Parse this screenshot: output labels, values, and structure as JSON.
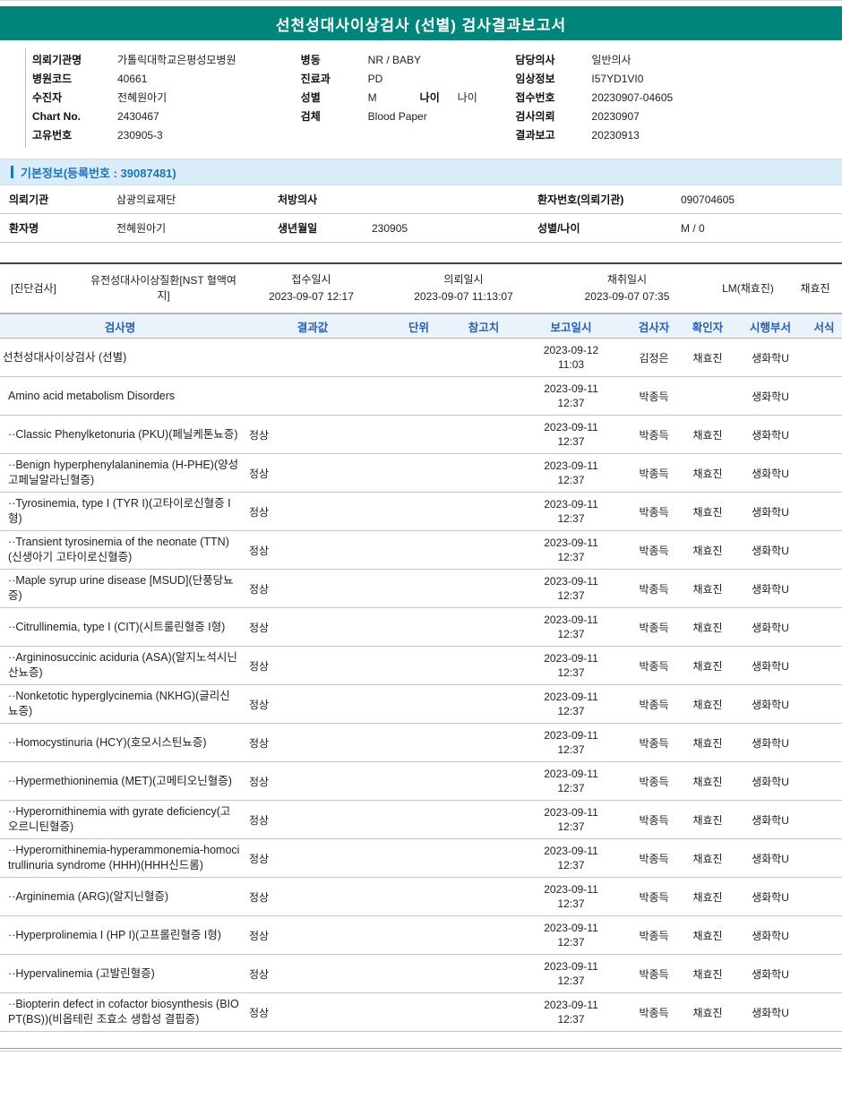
{
  "colors": {
    "brand_teal": "#00857B",
    "section_blue": "#1B75BC",
    "table_header_blue": "#2B5FAD"
  },
  "report": {
    "title": "선천성대사이상검사 (선별) 검사결과보고서"
  },
  "header_info": {
    "col1": [
      {
        "label": "의뢰기관명",
        "value": "가톨릭대학교은평성모병원"
      },
      {
        "label": "병원코드",
        "value": "40661"
      },
      {
        "label": "수진자",
        "value": "전혜원아기"
      },
      {
        "label": "Chart No.",
        "value": "2430467"
      },
      {
        "label": "고유번호",
        "value": "230905-3"
      }
    ],
    "col2": [
      {
        "label": "병동",
        "value": "NR / BABY"
      },
      {
        "label": "진료과",
        "value": "PD"
      },
      {
        "label": "성별",
        "value": "M",
        "label2": "나이",
        "value2": "나이"
      },
      {
        "label": "검체",
        "value": "Blood Paper"
      }
    ],
    "col3": [
      {
        "label": "담당의사",
        "value": "일반의사"
      },
      {
        "label": "임상정보",
        "value": "I57YD1VI0"
      },
      {
        "label": "접수번호",
        "value": "20230907-04605"
      },
      {
        "label": "검사의뢰",
        "value": "20230907"
      },
      {
        "label": "결과보고",
        "value": "20230913"
      }
    ]
  },
  "basic_info": {
    "section_title": "기본정보(등록번호 : 39087481)",
    "rows": [
      [
        {
          "label": "의뢰기관",
          "value": "삼광의료재단"
        },
        {
          "label": "처방의사",
          "value": ""
        },
        {
          "label": "환자번호(의뢰기관)",
          "value": "090704605"
        }
      ],
      [
        {
          "label": "환자명",
          "value": "전혜원아기"
        },
        {
          "label": "생년월일",
          "value": "230905"
        },
        {
          "label": "성별/나이",
          "value": "M / 0"
        }
      ]
    ]
  },
  "diagnosis": {
    "tag": "[진단검사]",
    "test_group": "유전성대사이상질환[NST 혈액여지]",
    "columns": [
      {
        "label": "접수일시",
        "value": "2023-09-07 12:17"
      },
      {
        "label": "의뢰일시",
        "value": "2023-09-07 11:13:07"
      },
      {
        "label": "채취일시",
        "value": "2023-09-07 07:35"
      }
    ],
    "collector": "LM(채효진)",
    "confirmer": "채효진"
  },
  "results_table": {
    "headers": [
      "검사명",
      "결과값",
      "단위",
      "참고치",
      "보고일시",
      "검사자",
      "확인자",
      "시행부서",
      "서식"
    ],
    "rows": [
      {
        "name": "선천성대사이상검사 (선별)",
        "indent": 0,
        "result": "",
        "unit": "",
        "ref": "",
        "reported": "2023-09-12 11:03",
        "tester": "김정은",
        "confirmer": "채효진",
        "dept": "생화학U"
      },
      {
        "name": "Amino acid metabolism Disorders",
        "indent": 1,
        "result": "",
        "unit": "",
        "ref": "",
        "reported": "2023-09-11 12:37",
        "tester": "박종득",
        "confirmer": "",
        "dept": "생화학U"
      },
      {
        "name": "··Classic Phenylketonuria (PKU)(페닐케톤뇨증)",
        "indent": 1,
        "result": "정상",
        "unit": "",
        "ref": "",
        "reported": "2023-09-11 12:37",
        "tester": "박종득",
        "confirmer": "채효진",
        "dept": "생화학U"
      },
      {
        "name": "··Benign hyperphenylalaninemia (H-PHE)(양성 고페닐알라닌혈증)",
        "indent": 1,
        "result": "정상",
        "unit": "",
        "ref": "",
        "reported": "2023-09-11 12:37",
        "tester": "박종득",
        "confirmer": "채효진",
        "dept": "생화학U"
      },
      {
        "name": "··Tyrosinemia, type I (TYR I)(고타이로신혈증 I형)",
        "indent": 1,
        "result": "정상",
        "unit": "",
        "ref": "",
        "reported": "2023-09-11 12:37",
        "tester": "박종득",
        "confirmer": "채효진",
        "dept": "생화학U"
      },
      {
        "name": "··Transient tyrosinemia of the neonate (TTN)(신생아기 고타이로신혈증)",
        "indent": 1,
        "result": "정상",
        "unit": "",
        "ref": "",
        "reported": "2023-09-11 12:37",
        "tester": "박종득",
        "confirmer": "채효진",
        "dept": "생화학U"
      },
      {
        "name": "··Maple syrup urine disease [MSUD](단풍당뇨증)",
        "indent": 1,
        "result": "정상",
        "unit": "",
        "ref": "",
        "reported": "2023-09-11 12:37",
        "tester": "박종득",
        "confirmer": "채효진",
        "dept": "생화학U"
      },
      {
        "name": "··Citrullinemia, type I (CIT)(시트룰린혈증 I형)",
        "indent": 1,
        "result": "정상",
        "unit": "",
        "ref": "",
        "reported": "2023-09-11 12:37",
        "tester": "박종득",
        "confirmer": "채효진",
        "dept": "생화학U"
      },
      {
        "name": "··Argininosuccinic aciduria (ASA)(알지노석시닌산뇨증)",
        "indent": 1,
        "result": "정상",
        "unit": "",
        "ref": "",
        "reported": "2023-09-11 12:37",
        "tester": "박종득",
        "confirmer": "채효진",
        "dept": "생화학U"
      },
      {
        "name": "··Nonketotic hyperglycinemia (NKHG)(글리신뇨증)",
        "indent": 1,
        "result": "정상",
        "unit": "",
        "ref": "",
        "reported": "2023-09-11 12:37",
        "tester": "박종득",
        "confirmer": "채효진",
        "dept": "생화학U"
      },
      {
        "name": "··Homocystinuria (HCY)(호모시스틴뇨증)",
        "indent": 1,
        "result": "정상",
        "unit": "",
        "ref": "",
        "reported": "2023-09-11 12:37",
        "tester": "박종득",
        "confirmer": "채효진",
        "dept": "생화학U"
      },
      {
        "name": "··Hypermethioninemia (MET)(고메티오닌혈증)",
        "indent": 1,
        "result": "정상",
        "unit": "",
        "ref": "",
        "reported": "2023-09-11 12:37",
        "tester": "박종득",
        "confirmer": "채효진",
        "dept": "생화학U"
      },
      {
        "name": "··Hyperornithinemia with gyrate deficiency(고오르니틴혈증)",
        "indent": 1,
        "result": "정상",
        "unit": "",
        "ref": "",
        "reported": "2023-09-11 12:37",
        "tester": "박종득",
        "confirmer": "채효진",
        "dept": "생화학U"
      },
      {
        "name": "··Hyperornithinemia-hyperammonemia-homocitrullinuria syndrome (HHH)(HHH신드롬)",
        "indent": 1,
        "result": "정상",
        "unit": "",
        "ref": "",
        "reported": "2023-09-11 12:37",
        "tester": "박종득",
        "confirmer": "채효진",
        "dept": "생화학U"
      },
      {
        "name": "··Argininemia (ARG)(알지닌혈증)",
        "indent": 1,
        "result": "정상",
        "unit": "",
        "ref": "",
        "reported": "2023-09-11 12:37",
        "tester": "박종득",
        "confirmer": "채효진",
        "dept": "생화학U"
      },
      {
        "name": "··Hyperprolinemia I (HP I)(고프롤린혈증 I형)",
        "indent": 1,
        "result": "정상",
        "unit": "",
        "ref": "",
        "reported": "2023-09-11 12:37",
        "tester": "박종득",
        "confirmer": "채효진",
        "dept": "생화학U"
      },
      {
        "name": "··Hypervalinemia (고발린혈증)",
        "indent": 1,
        "result": "정상",
        "unit": "",
        "ref": "",
        "reported": "2023-09-11 12:37",
        "tester": "박종득",
        "confirmer": "채효진",
        "dept": "생화학U"
      },
      {
        "name": "··Biopterin defect in cofactor biosynthesis (BIOPT(BS))(비옵테린 조효소 생합성 결핍증)",
        "indent": 1,
        "result": "정상",
        "unit": "",
        "ref": "",
        "reported": "2023-09-11 12:37",
        "tester": "박종득",
        "confirmer": "채효진",
        "dept": "생화학U"
      }
    ]
  }
}
